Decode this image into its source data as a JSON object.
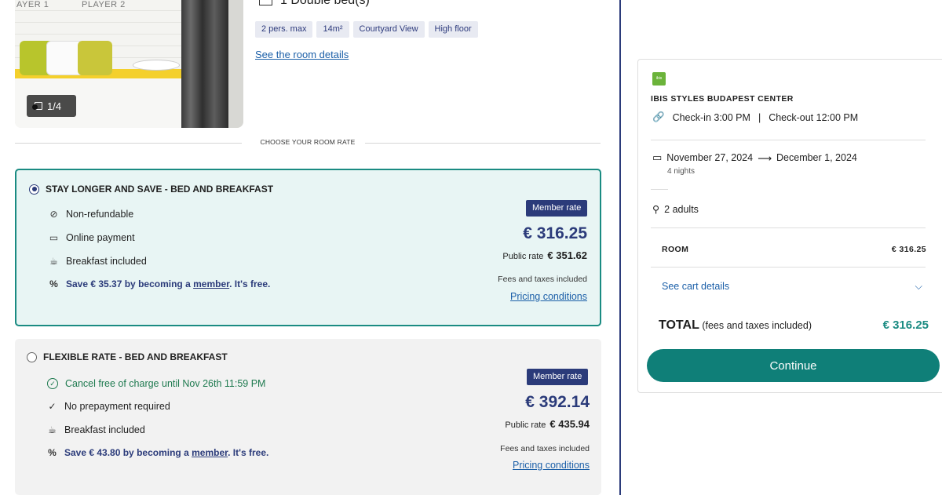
{
  "room": {
    "photo_counter": "1/4",
    "wall_text_1": "AYER 1",
    "wall_text_2": "PLAYER 2",
    "bed_text": "1 Double bed(s)",
    "tags": [
      "2 pers. max",
      "14m²",
      "Courtyard View",
      "High floor"
    ],
    "details_link": "See the room details"
  },
  "rate_section_label": "CHOOSE YOUR ROOM RATE",
  "rates": [
    {
      "title": "STAY LONGER AND SAVE - BED AND BREAKFAST",
      "selected": true,
      "features": [
        {
          "icon": "non-refundable-icon",
          "glyph": "⊘",
          "text": "Non-refundable"
        },
        {
          "icon": "card-icon",
          "glyph": "▭",
          "text": "Online payment"
        },
        {
          "icon": "breakfast-icon",
          "glyph": "☕",
          "text": "Breakfast included"
        }
      ],
      "save_prefix": "Save € 35.37 by becoming a ",
      "save_link": "member",
      "save_suffix": ". It's free.",
      "badge": "Member rate",
      "price": "€ 316.25",
      "public_label": "Public rate",
      "public_price": "€ 351.62",
      "fees": "Fees and taxes included",
      "pricing_link": "Pricing conditions"
    },
    {
      "title": "FLEXIBLE RATE - BED AND BREAKFAST",
      "selected": false,
      "features": [
        {
          "icon": "check-circle-icon",
          "glyph": "✓",
          "text": "Cancel free of charge until Nov 26th 11:59 PM"
        },
        {
          "icon": "check-icon",
          "glyph": "✓",
          "text": "No prepayment required"
        },
        {
          "icon": "breakfast-icon",
          "glyph": "☕",
          "text": "Breakfast included"
        }
      ],
      "save_prefix": "Save € 43.80 by becoming a ",
      "save_link": "member",
      "save_suffix": ". It's free.",
      "badge": "Member rate",
      "price": "€ 392.14",
      "public_label": "Public rate",
      "public_price": "€ 435.94",
      "fees": "Fees and taxes included",
      "pricing_link": "Pricing conditions"
    }
  ],
  "summary": {
    "logo_text": "ibis",
    "hotel_name": "IBIS STYLES BUDAPEST CENTER",
    "checkin": "Check-in 3:00 PM",
    "sep": "|",
    "checkout": "Check-out 12:00 PM",
    "date_from": "November 27, 2024",
    "arrow": "⟶",
    "date_to": "December 1, 2024",
    "nights": "4 nights",
    "guests": "2 adults",
    "room_label": "ROOM",
    "room_price": "€ 316.25",
    "cart_link": "See cart details",
    "total_label": "TOTAL",
    "total_note": " (fees and taxes included)",
    "total_price": "€ 316.25",
    "continue_label": "Continue"
  },
  "colors": {
    "brand_navy": "#2b3b7a",
    "teal": "#1a8b82",
    "button": "#0f7f78",
    "link": "#1b5fa8",
    "green_text": "#1e7a4f"
  }
}
